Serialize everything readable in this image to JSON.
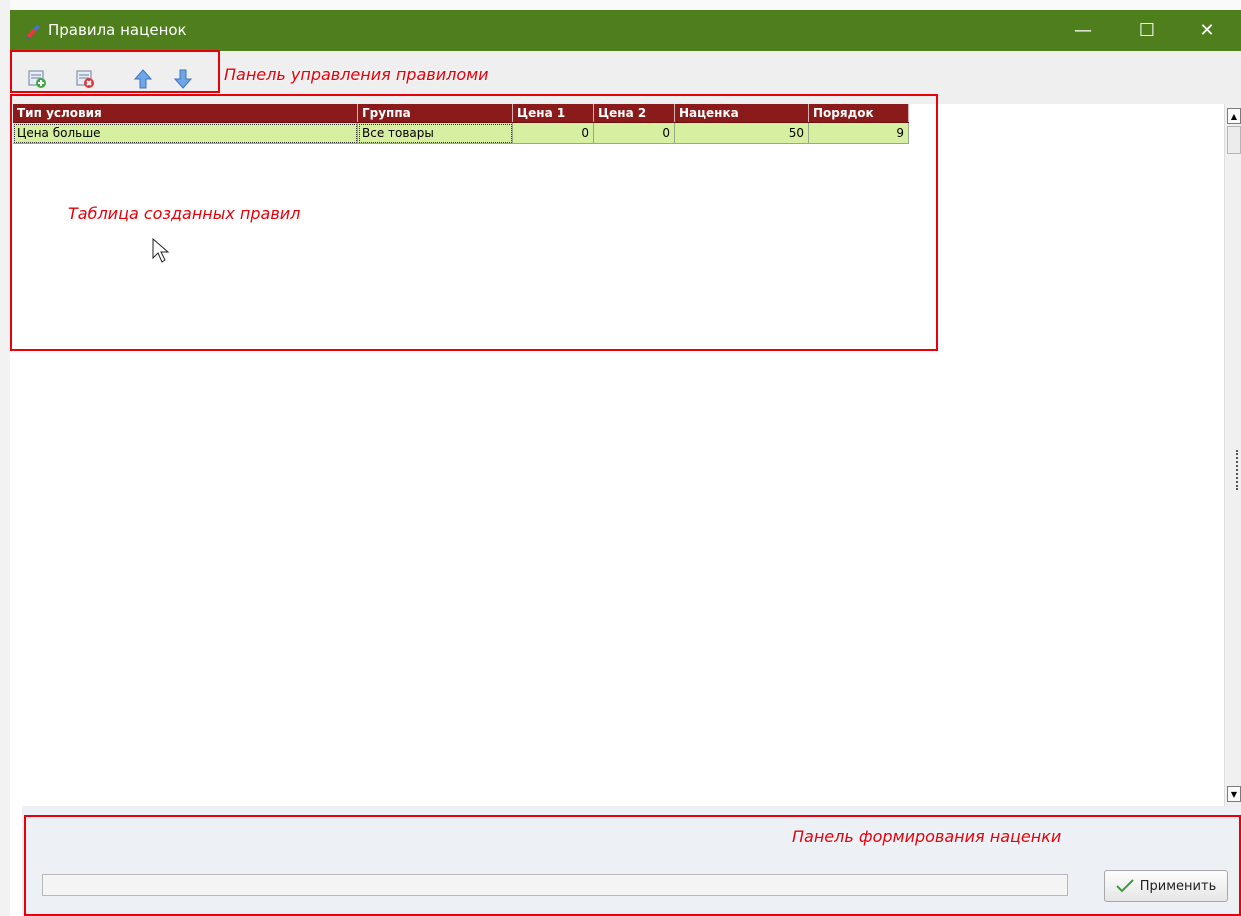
{
  "window": {
    "title": "Правила наценок",
    "minimize_glyph": "—",
    "maximize_glyph": "☐",
    "close_glyph": "✕"
  },
  "toolbar": {
    "buttons": [
      {
        "name": "add-rule-icon",
        "tooltip": ""
      },
      {
        "name": "delete-rule-icon",
        "tooltip": ""
      },
      {
        "name": "arrow-up-icon",
        "tooltip": ""
      },
      {
        "name": "arrow-down-icon",
        "tooltip": ""
      }
    ]
  },
  "annotations": {
    "toolbar": "Панель управления правиломи",
    "table": "Таблица созданных правил",
    "bottom": "Панель формирования наценки"
  },
  "table": {
    "columns": [
      "Тип условия",
      "Группа",
      "Цена 1",
      "Цена 2",
      "Наценка",
      "Порядок"
    ],
    "rows": [
      [
        "Цена больше",
        "Все товары",
        "0",
        "0",
        "50",
        "9"
      ]
    ]
  },
  "bottom_panel": {
    "apply_label": "Применить"
  },
  "colors": {
    "titlebar": "#4f7f1d",
    "header": "#8b1a1a",
    "row": "#d7efa1",
    "annotation": "#e8000a"
  }
}
